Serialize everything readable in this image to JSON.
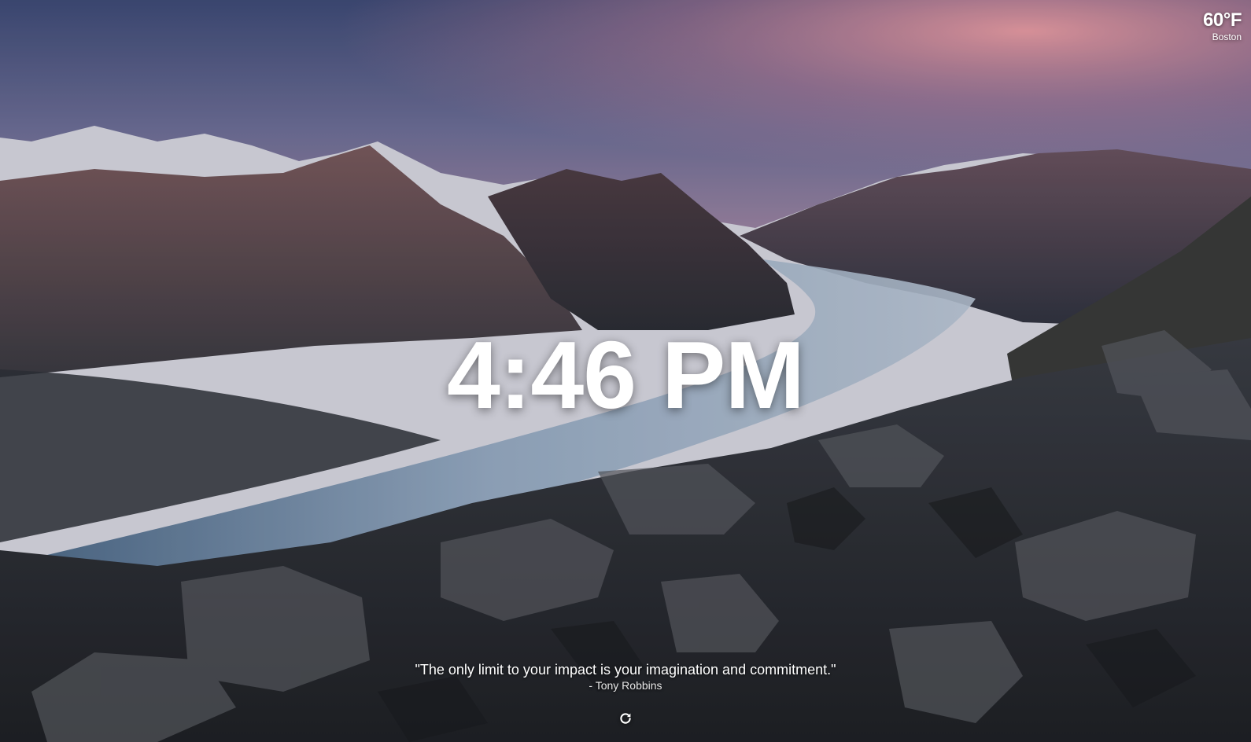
{
  "weather": {
    "temperature": "60°F",
    "city": "Boston"
  },
  "clock": {
    "time": "4:46 PM"
  },
  "quote": {
    "text": "\"The only limit to your impact is your imagination and commitment.\"",
    "author": "- Tony Robbins"
  },
  "controls": {
    "refresh_icon": "refresh-icon"
  },
  "colors": {
    "text": "#ffffff"
  }
}
